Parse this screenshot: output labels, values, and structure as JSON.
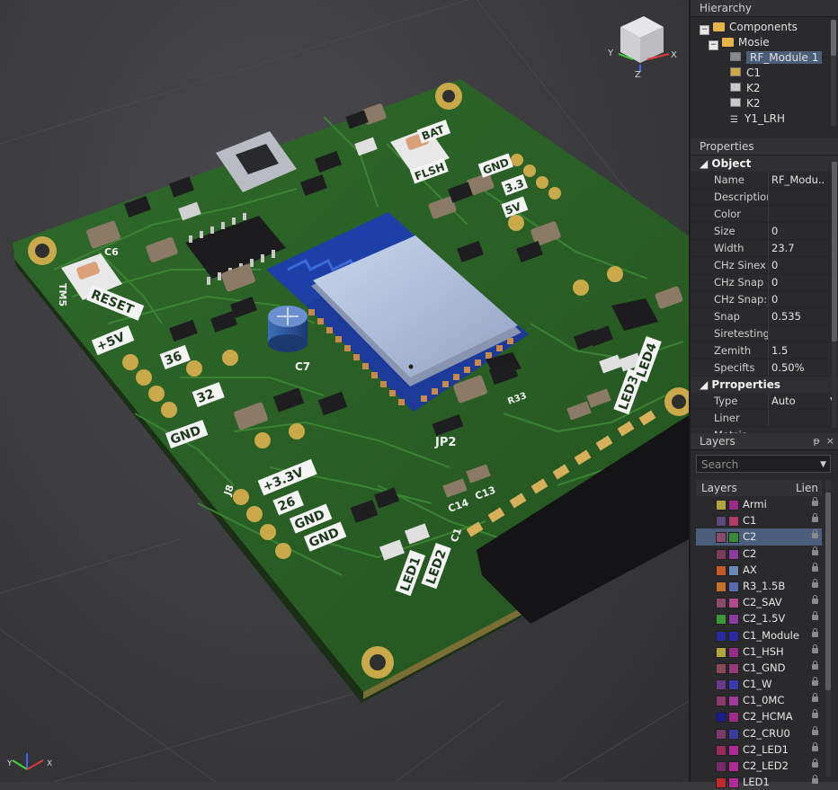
{
  "hierarchy": {
    "title": "Hierarchy",
    "items": [
      {
        "label": "Components",
        "kind": "folder",
        "expanded": true
      },
      {
        "label": "Mosie",
        "kind": "folder",
        "expanded": true
      },
      {
        "label": "RF_Module 1",
        "kind": "component",
        "selected": true
      },
      {
        "label": "C1",
        "kind": "component"
      },
      {
        "label": "K2",
        "kind": "component"
      },
      {
        "label": "K2",
        "kind": "component"
      },
      {
        "label": "Y1_LRH",
        "kind": "list"
      }
    ]
  },
  "properties": {
    "title": "Properties",
    "section1": "Object",
    "rows": [
      {
        "key": "Name",
        "value": "RF_Modu..."
      },
      {
        "key": "Description",
        "value": ""
      },
      {
        "key": "Color",
        "value": ""
      },
      {
        "key": "Size",
        "value": "0"
      },
      {
        "key": "Width",
        "value": "23.7"
      },
      {
        "key": "CHz Sinex",
        "value": "0"
      },
      {
        "key": "CHz Snap",
        "value": "0"
      },
      {
        "key": "CHz Snap:",
        "value": "0"
      },
      {
        "key": "Snap",
        "value": "0.535"
      },
      {
        "key": "Siretesting",
        "value": ""
      },
      {
        "key": "Zemith",
        "value": "1.5"
      },
      {
        "key": "Specifts",
        "value": "0.50%"
      }
    ],
    "section2": "Prroperties",
    "rows2": [
      {
        "key": "Type",
        "value": "Auto"
      },
      {
        "key": "Liner",
        "value": ""
      }
    ],
    "section3": "Matsis"
  },
  "layers": {
    "title": "Layers",
    "pin_glyph": "ᵽ",
    "close_glyph": "×",
    "search_placeholder": "Search",
    "col_layers": "Layers",
    "col_lien": "Lien",
    "items": [
      {
        "name": "Armi",
        "c1": "#b0a43a",
        "c2": "#9b2a8a"
      },
      {
        "name": "C1",
        "c1": "#5c4a78",
        "c2": "#b43a6a"
      },
      {
        "name": "C2",
        "c1": "#8a4a6a",
        "c2": "#3a8a3a",
        "selected": true
      },
      {
        "name": "C2",
        "c1": "#7a3a5a",
        "c2": "#8a3aa0"
      },
      {
        "name": "AX",
        "c1": "#c85a2a",
        "c2": "#6a8ab8"
      },
      {
        "name": "R3_1.5B",
        "c1": "#c8702a",
        "c2": "#5a6ab0"
      },
      {
        "name": "C2_SAV",
        "c1": "#8a4a6a",
        "c2": "#b04a8a"
      },
      {
        "name": "C2_1.5V",
        "c1": "#3a9a3a",
        "c2": "#8a3aa0"
      },
      {
        "name": "C1_Module",
        "c1": "#2a2aa0",
        "c2": "#2a2aa0"
      },
      {
        "name": "C1_HSH",
        "c1": "#b0a43a",
        "c2": "#9a2a8a"
      },
      {
        "name": "C1_GND",
        "c1": "#8a4a5a",
        "c2": "#9a3a7a"
      },
      {
        "name": "C1_W",
        "c1": "#6a3a8a",
        "c2": "#3a3ab0"
      },
      {
        "name": "C1_0MC",
        "c1": "#8a3a6a",
        "c2": "#a03a9a"
      },
      {
        "name": "C2_HCMA",
        "c1": "#1a1a8a",
        "c2": "#a02a8a"
      },
      {
        "name": "C2_CRU0",
        "c1": "#7a3a6a",
        "c2": "#3a3aa0"
      },
      {
        "name": "C2_LED1",
        "c1": "#9a2a5a",
        "c2": "#b02a9a"
      },
      {
        "name": "C2_LED2",
        "c1": "#7a2a6a",
        "c2": "#b02a9a"
      },
      {
        "name": "LED1",
        "c1": "#c02a2a",
        "c2": "#b02a9a"
      }
    ]
  },
  "viewcube": {
    "x_label": "Y",
    "y_label": "X",
    "z_label": "Z"
  },
  "triad": {
    "x_label": "Y",
    "y_label": "X"
  },
  "board_labels": {
    "reset": "RESET",
    "tm5": "TM5",
    "v5": "+5V",
    "n36": "36",
    "n32": "32",
    "gnd1": "GND",
    "v33": "+3.3V",
    "n26": "26",
    "gnd2": "GND",
    "gnd3": "GND",
    "led1": "LED1",
    "led2": "LED2",
    "led3": "LED3",
    "led4": "LED4",
    "jp2": "JP2",
    "c7": "C7",
    "c6": "C6",
    "c14": "C14",
    "c13": "C13",
    "r33": "R33",
    "j8": "J8",
    "c1": "C1",
    "bat": "BAT",
    "gnd_top": "GND",
    "v33_top": "3.3",
    "flsh": "FLSH",
    "sv": "5V"
  }
}
